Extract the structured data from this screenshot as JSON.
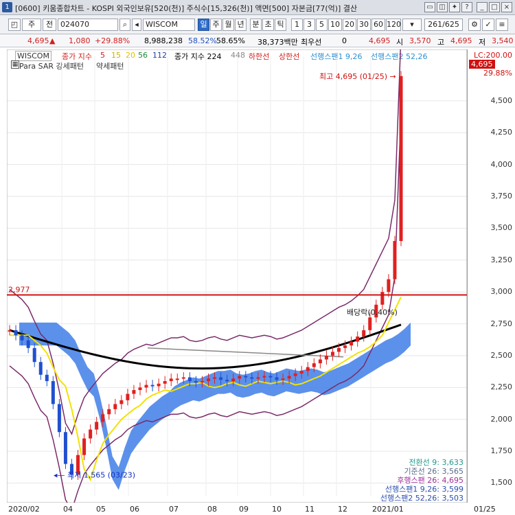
{
  "window": {
    "title": "[0600] 키움종합차트 - KOSPI 외국인보유[520(천)] 주식수[15,326(천)] 액면[500] 자본금[77(억)] 결산",
    "icon": "1"
  },
  "toolbar": {
    "type_sel": "주",
    "prev": "전",
    "code": "024070",
    "name": "WISCOM",
    "periods": [
      "일",
      "주",
      "월",
      "년",
      "분",
      "초",
      "틱"
    ],
    "active_period": "일",
    "minutes": [
      "1",
      "3",
      "5",
      "10",
      "20",
      "30",
      "60",
      "120"
    ],
    "page": "261/625"
  },
  "info": {
    "price": "4,695",
    "arrow": "▲",
    "change": "1,080",
    "pct": "+29.88%",
    "volume": "8,988,238",
    "r1": "58.52%",
    "r2": "58.65%",
    "amount": "38,373백만",
    "pref_label": "최우선",
    "pref_val": "0",
    "cur": "4,695",
    "open_label": "시",
    "open": "3,570",
    "high_label": "고",
    "high": "4,695",
    "low_label": "저",
    "low": "3,540"
  },
  "legend": {
    "name": "WISCOM",
    "ma_label": "종가 지수",
    "ma5": "5",
    "ma15": "15",
    "ma20": "20",
    "ma56": "56",
    "ma112": "112",
    "ma224_label": "종가 지수 224",
    "ma448": "448",
    "lower": "하한선",
    "upper": "상한선",
    "span1": "선행스팬1 9,26",
    "span2": "선행스팬2 52,26",
    "sar": "Para SAR 강세패턴",
    "sar2": "약세패턴"
  },
  "chart_data": {
    "type": "candlestick",
    "ylim": [
      1400,
      4850
    ],
    "yticks": [
      1500,
      1750,
      2000,
      2250,
      2500,
      2750,
      3000,
      3250,
      3500,
      3750,
      4000,
      4250,
      4500
    ],
    "ytick_labels": [
      "1,500",
      "1,750",
      "2,000",
      "2,250",
      "2,500",
      "2,750",
      "3,000",
      "3,250",
      "3,500",
      "3,750",
      "4,000",
      "4,250",
      "4,500"
    ],
    "xlabels": [
      "2020/02",
      "04",
      "05",
      "06",
      "07",
      "08",
      "09",
      "10",
      "11",
      "12",
      "2021/01",
      "01/25"
    ],
    "lc_label": "LC:200.00",
    "last_price": "4,695",
    "last_pct": "29.88%",
    "hline": 2977,
    "hline_label": "2,977",
    "high_note": "최고 4,695 (01/25)",
    "low_note": "최저 1,565 (03/23)",
    "div_note": "배당락(0.40%)",
    "closes": [
      2700,
      2660,
      2620,
      2560,
      2450,
      2350,
      2300,
      2120,
      1900,
      1650,
      1565,
      1720,
      1850,
      1920,
      1980,
      2040,
      2080,
      2120,
      2150,
      2200,
      2230,
      2250,
      2270,
      2260,
      2280,
      2300,
      2320,
      2320,
      2330,
      2300,
      2290,
      2300,
      2320,
      2330,
      2310,
      2300,
      2320,
      2340,
      2330,
      2320,
      2330,
      2340,
      2330,
      2310,
      2320,
      2340,
      2360,
      2380,
      2410,
      2440,
      2470,
      2500,
      2530,
      2560,
      2580,
      2610,
      2650,
      2700,
      2800,
      2900,
      3000,
      3100,
      3400,
      4695
    ]
  },
  "stats": [
    {
      "label": "전환선 9",
      "val": "3,633",
      "color": "#1f9a8a"
    },
    {
      "label": "기준선 26",
      "val": "3,565",
      "color": "#5a6a8a"
    },
    {
      "label": "후행스팬 26",
      "val": "4,695",
      "color": "#a0309a"
    },
    {
      "label": "선행스팬1 9,26",
      "val": "3,599",
      "color": "#2c4fb0"
    },
    {
      "label": "선행스팬2 52,26",
      "val": "3,503",
      "color": "#2c4fb0"
    }
  ]
}
